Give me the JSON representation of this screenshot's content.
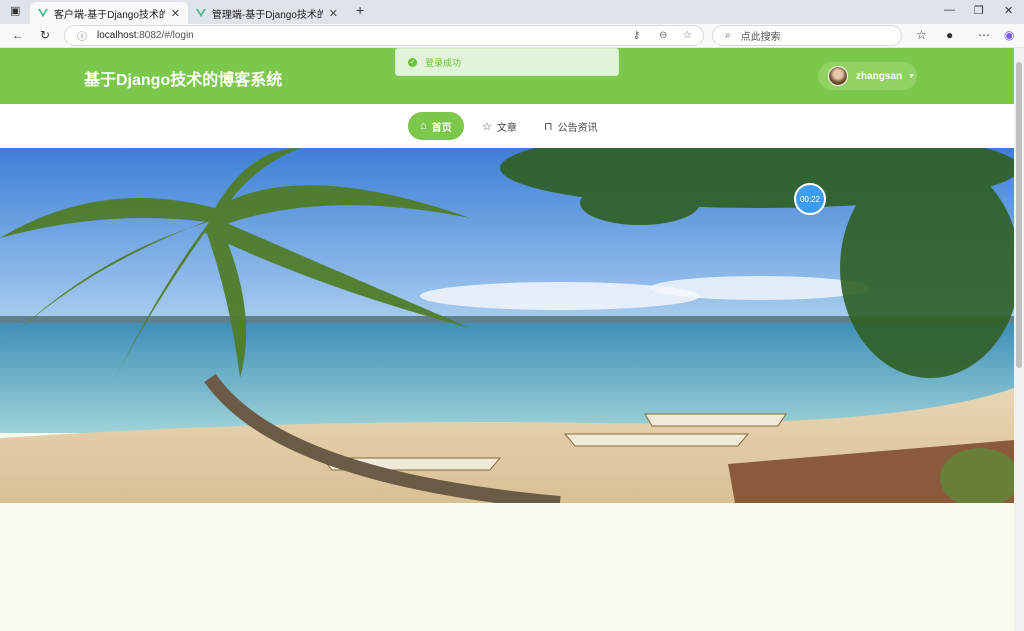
{
  "browser": {
    "tabs": [
      {
        "title": "客户端-基于Django技术的博客系统"
      },
      {
        "title": "管理端-基于Django技术的博客系统"
      }
    ],
    "address_host": "localhost",
    "address_path": ":8082/#/login",
    "search_placeholder": "点此搜索"
  },
  "header": {
    "site_title": "基于Django技术的博客系统",
    "username": "zhangsan"
  },
  "toast": {
    "message": "登录成功"
  },
  "nav": {
    "items": [
      {
        "label": "首页",
        "icon": "home-icon",
        "active": true
      },
      {
        "label": "文章",
        "icon": "star-icon",
        "active": false
      },
      {
        "label": "公告资讯",
        "icon": "bag-icon",
        "active": false
      }
    ]
  },
  "banner": {
    "timer": "00:22"
  },
  "colors": {
    "brand_green": "#7cc84c",
    "timer_blue": "#3b9cf2"
  }
}
